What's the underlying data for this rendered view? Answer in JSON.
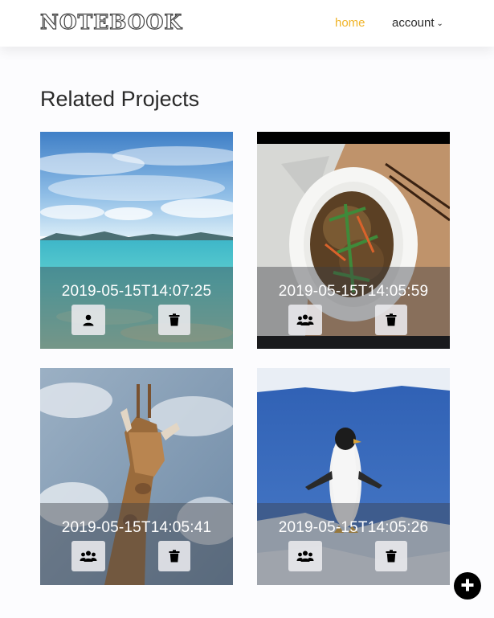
{
  "header": {
    "logo": "NOTEBOOK",
    "nav": {
      "home": "home",
      "account": "account"
    },
    "accent_color": "#f0b429"
  },
  "main": {
    "title": "Related Projects",
    "projects": [
      {
        "timestamp": "2019-05-15T14:07:25",
        "image": "ocean-sky",
        "share_icon": "person-icon",
        "delete_icon": "trash-icon"
      },
      {
        "timestamp": "2019-05-15T14:05:59",
        "image": "noodle-dish",
        "share_icon": "group-icon",
        "delete_icon": "trash-icon"
      },
      {
        "timestamp": "2019-05-15T14:05:41",
        "image": "giraffe",
        "share_icon": "group-icon",
        "delete_icon": "trash-icon"
      },
      {
        "timestamp": "2019-05-15T14:05:26",
        "image": "penguin",
        "share_icon": "group-icon",
        "delete_icon": "trash-icon"
      }
    ]
  },
  "fab": {
    "icon": "plus-icon"
  }
}
